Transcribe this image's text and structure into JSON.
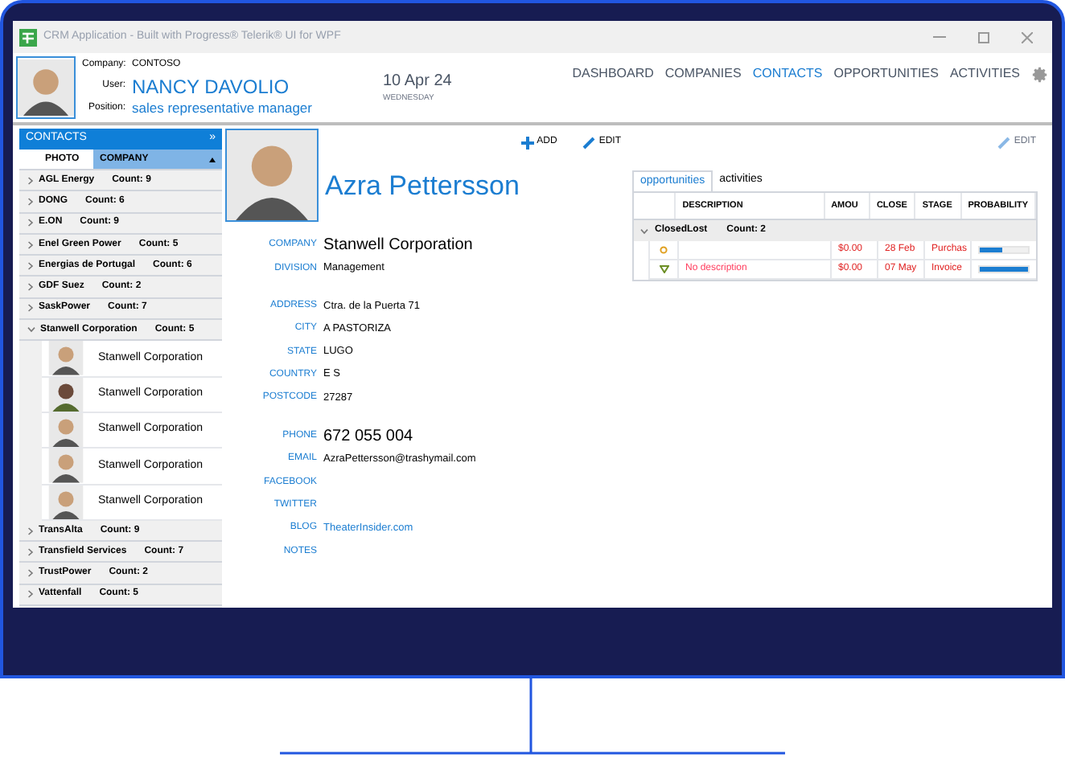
{
  "window": {
    "title": "CRM Application - Built with Progress® Telerik® UI for WPF"
  },
  "header": {
    "company_label": "Company:",
    "company": "CONTOSO",
    "user_label": "User:",
    "user": "NANCY DAVOLIO",
    "position_label": "Position:",
    "position": "sales representative manager",
    "date": "10 Apr 24",
    "weekday": "WEDNESDAY"
  },
  "nav": [
    {
      "label": "DASHBOARD",
      "selected": false
    },
    {
      "label": "COMPANIES",
      "selected": false
    },
    {
      "label": "CONTACTS",
      "selected": true
    },
    {
      "label": "OPPORTUNITIES",
      "selected": false
    },
    {
      "label": "ACTIVITIES",
      "selected": false
    }
  ],
  "contacts_panel": {
    "title": "CONTACTS",
    "collapse": "»",
    "columns": [
      {
        "label": "PHOTO",
        "sorted": false
      },
      {
        "label": "COMPANY",
        "sorted": true
      }
    ],
    "groups": [
      {
        "name": "AGL Energy",
        "count": "Count: 9",
        "expanded": false
      },
      {
        "name": "DONG",
        "count": "Count: 6",
        "expanded": false
      },
      {
        "name": "E.ON",
        "count": "Count: 9",
        "expanded": false
      },
      {
        "name": "Enel Green Power",
        "count": "Count: 5",
        "expanded": false
      },
      {
        "name": "Energias de Portugal",
        "count": "Count: 6",
        "expanded": false
      },
      {
        "name": "GDF Suez",
        "count": "Count: 2",
        "expanded": false
      },
      {
        "name": "SaskPower",
        "count": "Count: 7",
        "expanded": false
      },
      {
        "name": "Stanwell Corporation",
        "count": "Count: 5",
        "expanded": true,
        "children": [
          {
            "company": "Stanwell Corporation"
          },
          {
            "company": "Stanwell Corporation"
          },
          {
            "company": "Stanwell Corporation"
          },
          {
            "company": "Stanwell Corporation"
          },
          {
            "company": "Stanwell Corporation"
          }
        ]
      },
      {
        "name": "TransAlta",
        "count": "Count: 9",
        "expanded": false
      },
      {
        "name": "Transfield Services",
        "count": "Count: 7",
        "expanded": false
      },
      {
        "name": "TrustPower",
        "count": "Count: 2",
        "expanded": false
      },
      {
        "name": "Vattenfall",
        "count": "Count: 5",
        "expanded": false
      }
    ]
  },
  "toolbar": {
    "add": "ADD",
    "edit": "EDIT",
    "edit2": "EDIT"
  },
  "contact": {
    "name": "Azra Pettersson",
    "fields": [
      {
        "label": "COMPANY",
        "value": "Stanwell Corporation",
        "kind": "large"
      },
      {
        "label": "DIVISION",
        "value": "Management",
        "kind": "plain"
      },
      {
        "kind": "gap"
      },
      {
        "label": "ADDRESS",
        "value": "Ctra. de la Puerta 71",
        "kind": "plain"
      },
      {
        "label": "CITY",
        "value": "A  PASTORIZA",
        "kind": "plain"
      },
      {
        "label": "STATE",
        "value": "LUGO",
        "kind": "plain"
      },
      {
        "label": "COUNTRY",
        "value": "E S",
        "kind": "plain"
      },
      {
        "label": "POSTCODE",
        "value": "27287",
        "kind": "plain"
      },
      {
        "kind": "gap"
      },
      {
        "label": "PHONE",
        "value": "672 055 004",
        "kind": "large"
      },
      {
        "label": "EMAIL",
        "value": "AzraPettersson@trashymail.com",
        "kind": "plain"
      },
      {
        "label": "FACEBOOK",
        "kind": "plain"
      },
      {
        "label": "TWITTER",
        "kind": "plain"
      },
      {
        "label": "BLOG",
        "value": "TheaterInsider.com",
        "kind": "link"
      },
      {
        "label": "NOTES",
        "kind": "plain"
      }
    ]
  },
  "detail_tabs": [
    {
      "label": "opportunities",
      "selected": true
    },
    {
      "label": "activities",
      "selected": false
    }
  ],
  "opportunities": {
    "columns": [
      "DESCRIPTION",
      "AMOU",
      "CLOSE",
      "STAGE",
      "PROBABILITY"
    ],
    "group": {
      "name": "ClosedLost",
      "count": "Count: 2",
      "expanded": true
    },
    "rows": [
      {
        "kind": "circle",
        "description": "",
        "amount": "$0.00",
        "close": "28 Feb",
        "stage": "Purchas",
        "level": 0.45
      },
      {
        "kind": "triangle",
        "description": "No description",
        "amount": "$0.00",
        "close": "07 May",
        "stage": "Invoice",
        "level": 1.0
      }
    ]
  }
}
